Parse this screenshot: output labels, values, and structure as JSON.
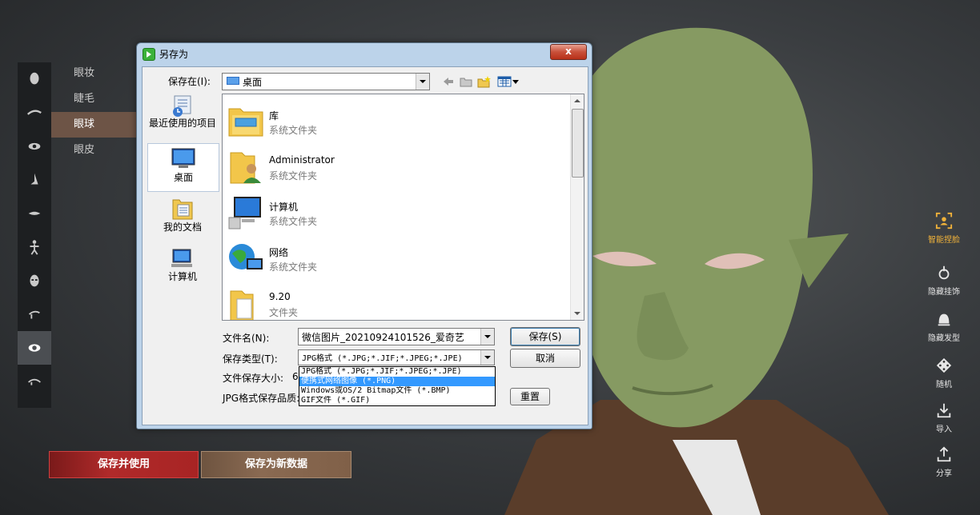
{
  "categories": [
    {
      "label": "眼妆",
      "active": false
    },
    {
      "label": "睫毛",
      "active": false
    },
    {
      "label": "眼球",
      "active": true
    },
    {
      "label": "眼皮",
      "active": false
    }
  ],
  "left_rail_icons": [
    "head-icon",
    "eyebrow-icon",
    "eye-icon",
    "nose-icon",
    "mouth-icon",
    "body-icon",
    "face-icon",
    "ear-icon",
    "eyeball-icon",
    "eyelid-icon"
  ],
  "right_tools": [
    {
      "label": "智能捏脸",
      "icon": "smart-face-icon"
    },
    {
      "label": "隐藏挂饰",
      "icon": "hide-accessory-icon"
    },
    {
      "label": "隐藏发型",
      "icon": "hide-hair-icon"
    },
    {
      "label": "随机",
      "icon": "random-icon"
    },
    {
      "label": "导入",
      "icon": "import-icon"
    },
    {
      "label": "分享",
      "icon": "share-icon"
    }
  ],
  "bottom": {
    "save_use": "保存并使用",
    "save_new": "保存为新数据"
  },
  "dialog": {
    "title": "另存为",
    "close": "x",
    "save_in_label": "保存在(I):",
    "save_in_value": "桌面",
    "places": [
      "最近使用的项目",
      "桌面",
      "我的文档",
      "计算机"
    ],
    "files": [
      {
        "name": "库",
        "type": "系统文件夹"
      },
      {
        "name": "Administrator",
        "type": "系统文件夹"
      },
      {
        "name": "计算机",
        "type": "系统文件夹"
      },
      {
        "name": "网络",
        "type": "系统文件夹"
      },
      {
        "name": "9.20",
        "type": "文件夹"
      }
    ],
    "filename_label": "文件名(N):",
    "filename_value": "微信图片_20210924101526_爱奇艺",
    "filetype_label": "保存类型(T):",
    "filetype_value": "JPG格式 (*.JPG;*.JIF;*.JPEG;*.JPE)",
    "filesize_label": "文件保存大小:",
    "filesize_value": "6",
    "quality_label": "JPG格式保存品质:",
    "save_btn": "保存(S)",
    "cancel_btn": "取消",
    "reset_btn": "重置",
    "filetype_options": [
      "JPG格式 (*.JPG;*.JIF;*.JPEG;*.JPE)",
      "便携式网络图像 (*.PNG)",
      "Windows或OS/2 Bitmap文件 (*.BMP)",
      "GIF文件 (*.GIF)"
    ],
    "highlighted_option_index": 1
  },
  "colors": {
    "dialog_frame": "#bcd3ea",
    "highlight": "#3399ff",
    "smart_face": "#f0b23a",
    "save_use_bg": "#a82424"
  }
}
